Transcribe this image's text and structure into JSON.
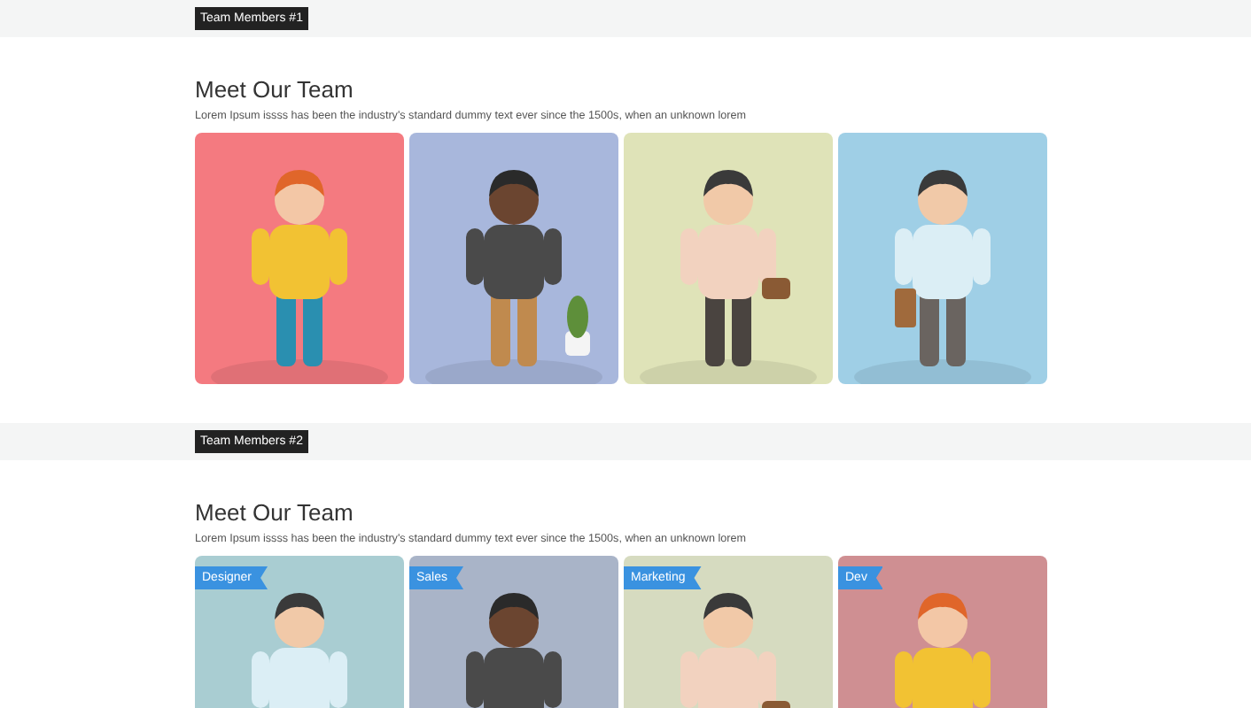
{
  "sections": [
    {
      "badge": "Team Members #1",
      "title": "Meet Our Team",
      "description": "Lorem Ipsum issss has been the industry's standard dummy text ever since the 1500s, when an unknown lorem"
    },
    {
      "badge": "Team Members #2",
      "title": "Meet Our Team",
      "description": "Lorem Ipsum issss has been the industry's standard dummy text ever since the 1500s, when an unknown lorem",
      "members": [
        {
          "kind": "picture",
          "tag": "Designer"
        },
        {
          "kind": "picture",
          "tag": "Sales"
        },
        {
          "kind": "picture",
          "tag": "Marketing"
        },
        {
          "kind": "picture",
          "tag": "Dev"
        }
      ]
    }
  ]
}
